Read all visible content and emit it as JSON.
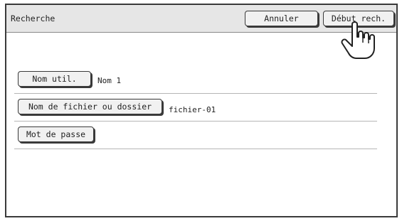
{
  "header": {
    "title": "Recherche",
    "cancel_label": "Annuler",
    "start_label": "Début rech."
  },
  "fields": [
    {
      "label": "Nom util.",
      "value": "Nom 1"
    },
    {
      "label": "Nom de fichier ou dossier",
      "value": "fichier-01"
    },
    {
      "label": "Mot de passe",
      "value": ""
    }
  ],
  "icons": {
    "pointer": "pointing-hand-icon"
  }
}
